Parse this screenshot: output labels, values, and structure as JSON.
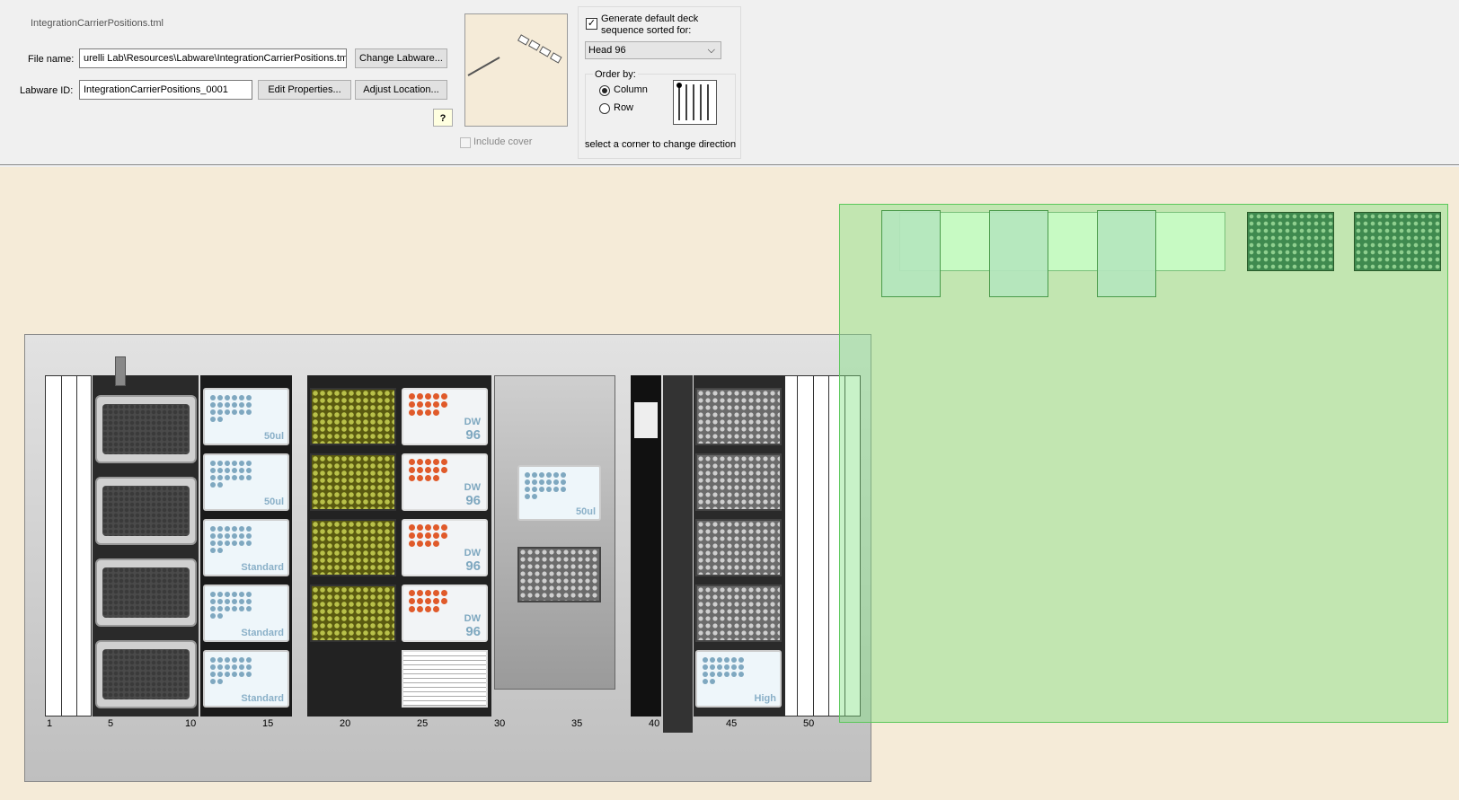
{
  "header": {
    "filename_caption": "IntegrationCarrierPositions.tml",
    "file_name_label": "File name:",
    "file_name_value": "urelli Lab\\Resources\\Labware\\IntegrationCarrierPositions.tml",
    "labware_id_label": "Labware ID:",
    "labware_id_value": "IntegrationCarrierPositions_0001",
    "change_labware_label": "Change Labware...",
    "edit_properties_label": "Edit Properties...",
    "adjust_location_label": "Adjust Location...",
    "include_cover_label": "Include cover",
    "include_cover_checked": false,
    "help_icon": "question-icon"
  },
  "sequence": {
    "generate_label": "Generate default deck sequence sorted for:",
    "generate_checked": true,
    "head_selected": "Head 96",
    "order_by_label": "Order by:",
    "column_label": "Column",
    "row_label": "Row",
    "selected_order": "Column",
    "hint": "select a corner to change direction"
  },
  "deck": {
    "ruler": [
      "1",
      "5",
      "10",
      "15",
      "20",
      "25",
      "30",
      "35",
      "40",
      "45",
      "50"
    ],
    "labels": {
      "fifty_ul": "50ul",
      "standard": "Standard",
      "dw": "DW",
      "n96": "96",
      "high": "High"
    }
  },
  "colors": {
    "canvas_bg": "#f5ebd8",
    "selection_green": "#7be07b",
    "olive_plate": "#5a5a10",
    "dw_dots": "#e05a2a",
    "tip_dots": "#7fa8c0"
  }
}
